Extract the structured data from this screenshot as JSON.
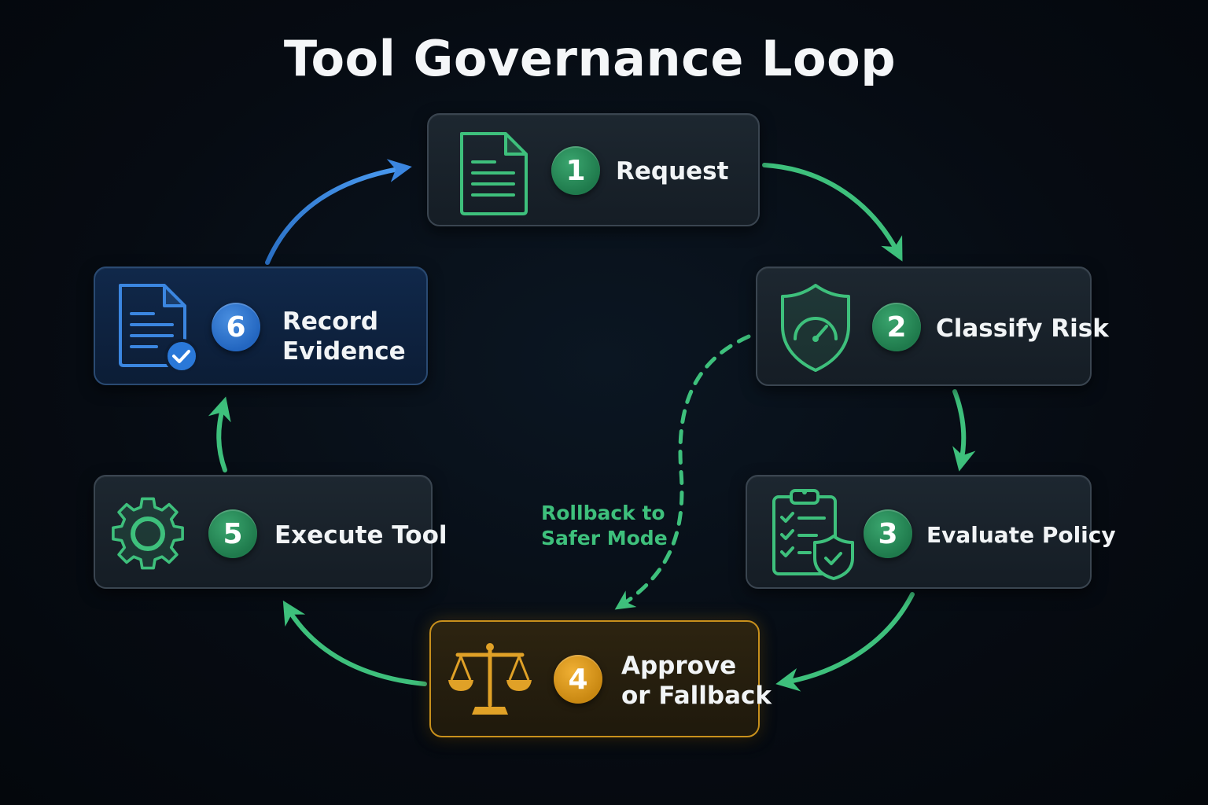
{
  "title": "Tool Governance Loop",
  "colors": {
    "green": "#3ec07c",
    "blue": "#3b86e0",
    "gold": "#e0a127",
    "background": "#060b12"
  },
  "steps": [
    {
      "number": "1",
      "line1": "Request",
      "line2": "",
      "icon": "document-icon"
    },
    {
      "number": "2",
      "line1": "Classify Risk",
      "line2": "",
      "icon": "shield-gauge-icon"
    },
    {
      "number": "3",
      "line1": "Evaluate Policy",
      "line2": "",
      "icon": "clipboard-checklist-icon"
    },
    {
      "number": "4",
      "line1": "Approve",
      "line2": "or Fallback",
      "icon": "scales-icon"
    },
    {
      "number": "5",
      "line1": "Execute Tool",
      "line2": "",
      "icon": "gear-icon"
    },
    {
      "number": "6",
      "line1": "Record",
      "line2": "Evidence",
      "icon": "document-check-icon"
    }
  ],
  "rollback": {
    "line1": "Rollback to",
    "line2": "Safer Mode"
  }
}
